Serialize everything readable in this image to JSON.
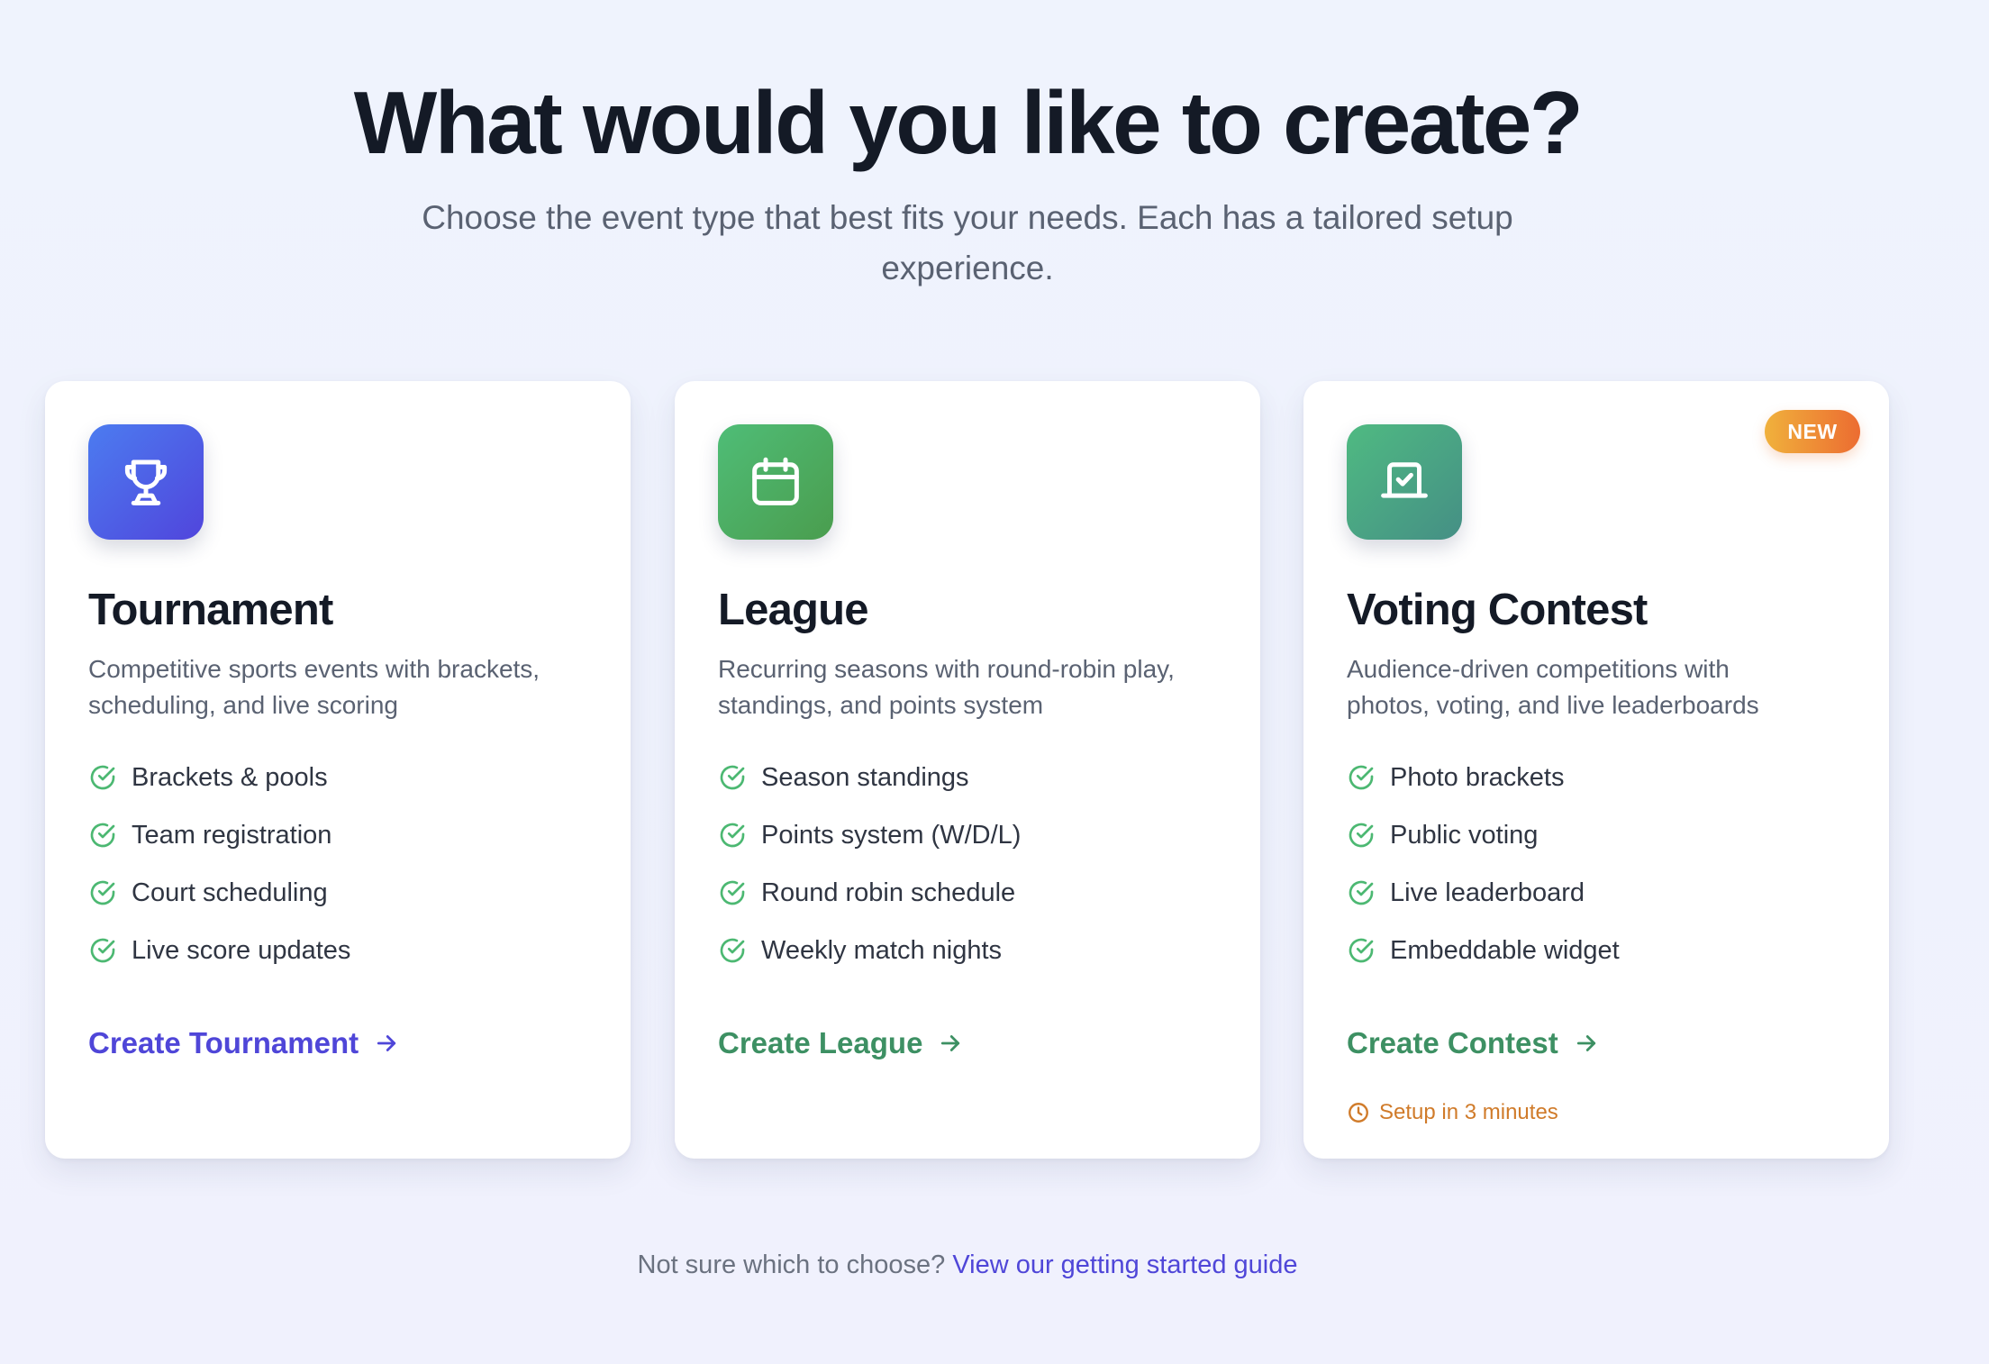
{
  "header": {
    "title": "What would you like to create?",
    "subtitle_line1": "Choose the event type that best fits your needs. Each has a tailored setup",
    "subtitle_line2": "experience."
  },
  "cards": [
    {
      "icon": "trophy-icon",
      "title": "Tournament",
      "description_line1": "Competitive sports events with brackets,",
      "description_line2": "scheduling, and live scoring",
      "features": [
        "Brackets & pools",
        "Team registration",
        "Court scheduling",
        "Live score updates"
      ],
      "cta_label": "Create Tournament",
      "accent_color": "#4f46d8"
    },
    {
      "icon": "calendar-icon",
      "title": "League",
      "description_line1": "Recurring seasons with round-robin play,",
      "description_line2": "standings, and points system",
      "features": [
        "Season standings",
        "Points system (W/D/L)",
        "Round robin schedule",
        "Weekly match nights"
      ],
      "cta_label": "Create League",
      "accent_color": "#3d9063"
    },
    {
      "icon": "ballot-box-icon",
      "title": "Voting Contest",
      "description_line1": "Audience-driven competitions with",
      "description_line2": "photos, voting, and live leaderboards",
      "features": [
        "Photo brackets",
        "Public voting",
        "Live leaderboard",
        "Embeddable widget"
      ],
      "cta_label": "Create Contest",
      "badge": "NEW",
      "setup_note": "Setup in 3 minutes",
      "accent_color": "#3d9063"
    }
  ],
  "footer": {
    "prompt": "Not sure which to choose?",
    "link_label": "View our getting started guide"
  },
  "colors": {
    "check": "#4cb872",
    "badge_start": "#f0b13c",
    "badge_end": "#ec6c31",
    "setup_note": "#d07b2a"
  }
}
